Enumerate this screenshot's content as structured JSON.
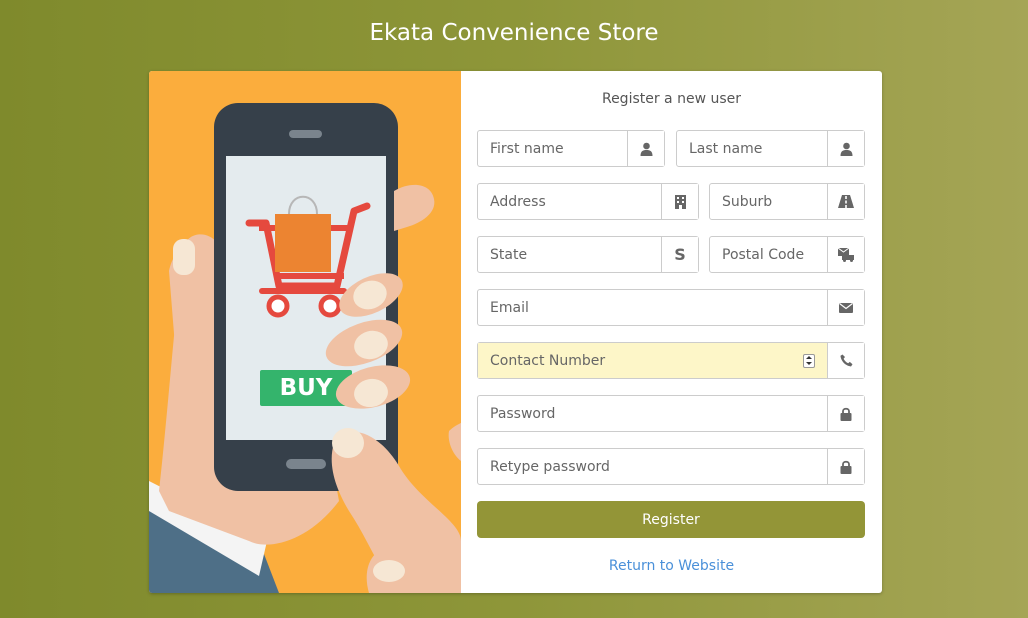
{
  "page": {
    "title": "Ekata Convenience Store"
  },
  "illustration": {
    "buy_label": "BUY"
  },
  "form": {
    "heading": "Register a new user",
    "fields": {
      "first_name": {
        "placeholder": "First name",
        "icon": "user-icon"
      },
      "last_name": {
        "placeholder": "Last name",
        "icon": "user-icon"
      },
      "address": {
        "placeholder": "Address",
        "icon": "building-icon"
      },
      "suburb": {
        "placeholder": "Suburb",
        "icon": "road-icon"
      },
      "state": {
        "placeholder": "State",
        "icon": "dollar-s-icon"
      },
      "postal_code": {
        "placeholder": "Postal Code",
        "icon": "mail-truck-icon"
      },
      "email": {
        "placeholder": "Email",
        "icon": "envelope-icon"
      },
      "contact_number": {
        "placeholder": "Contact Number",
        "icon": "phone-icon"
      },
      "password": {
        "placeholder": "Password",
        "icon": "lock-icon"
      },
      "retype_password": {
        "placeholder": "Retype password",
        "icon": "lock-icon"
      }
    },
    "register_label": "Register",
    "return_link": "Return to Website"
  },
  "colors": {
    "accent": "#939537",
    "link": "#4a90d9",
    "highlight_field": "#fdf6c8",
    "illustration_bg": "#fbad3d"
  }
}
